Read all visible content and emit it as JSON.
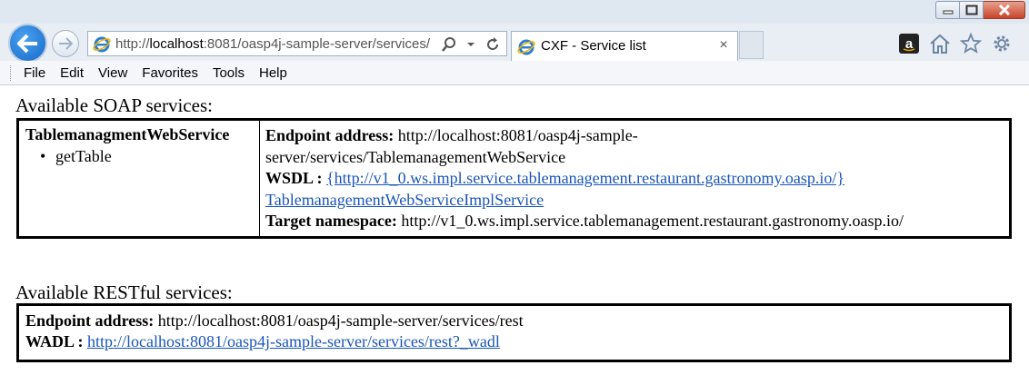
{
  "browser": {
    "address_host": "localhost",
    "address_prefix": "http://",
    "address_rest": ":8081/oasp4j-sample-server/services/",
    "tab_title": "CXF - Service list",
    "tab_close": "×",
    "icons": [
      "back-icon",
      "forward-icon",
      "ie-logo-icon",
      "search-icon",
      "dropdown-icon",
      "refresh-icon",
      "amazon-icon",
      "home-icon",
      "favorites-star-icon",
      "settings-gear-icon",
      "minimize-icon",
      "maximize-icon",
      "close-icon"
    ]
  },
  "menu": {
    "items": [
      "File",
      "Edit",
      "View",
      "Favorites",
      "Tools",
      "Help"
    ]
  },
  "soap": {
    "heading": "Available SOAP services:",
    "service_name": "TablemanagmentWebService",
    "operations": [
      "getTable"
    ],
    "endpoint_label": "Endpoint address:",
    "endpoint_value_line1": "http://localhost:8081/oasp4j-sample-",
    "endpoint_value_line2": "server/services/TablemanagementWebService",
    "wsdl_label": "WSDL :",
    "wsdl_link_line1": "{http://v1_0.ws.impl.service.tablemanagement.restaurant.gastronomy.oasp.io/}",
    "wsdl_link_line2": "TablemanagementWebServiceImplService",
    "namespace_label": "Target namespace:",
    "namespace_value": "http://v1_0.ws.impl.service.tablemanagement.restaurant.gastronomy.oasp.io/"
  },
  "rest": {
    "heading": "Available RESTful services:",
    "endpoint_label": "Endpoint address:",
    "endpoint_value": "http://localhost:8081/oasp4j-sample-server/services/rest",
    "wadl_label": "WADL :",
    "wadl_link": "http://localhost:8081/oasp4j-sample-server/services/rest?_wadl"
  },
  "colors": {
    "link": "#1a56b8",
    "back_button": "#1668c8",
    "close_button": "#c7432a"
  }
}
